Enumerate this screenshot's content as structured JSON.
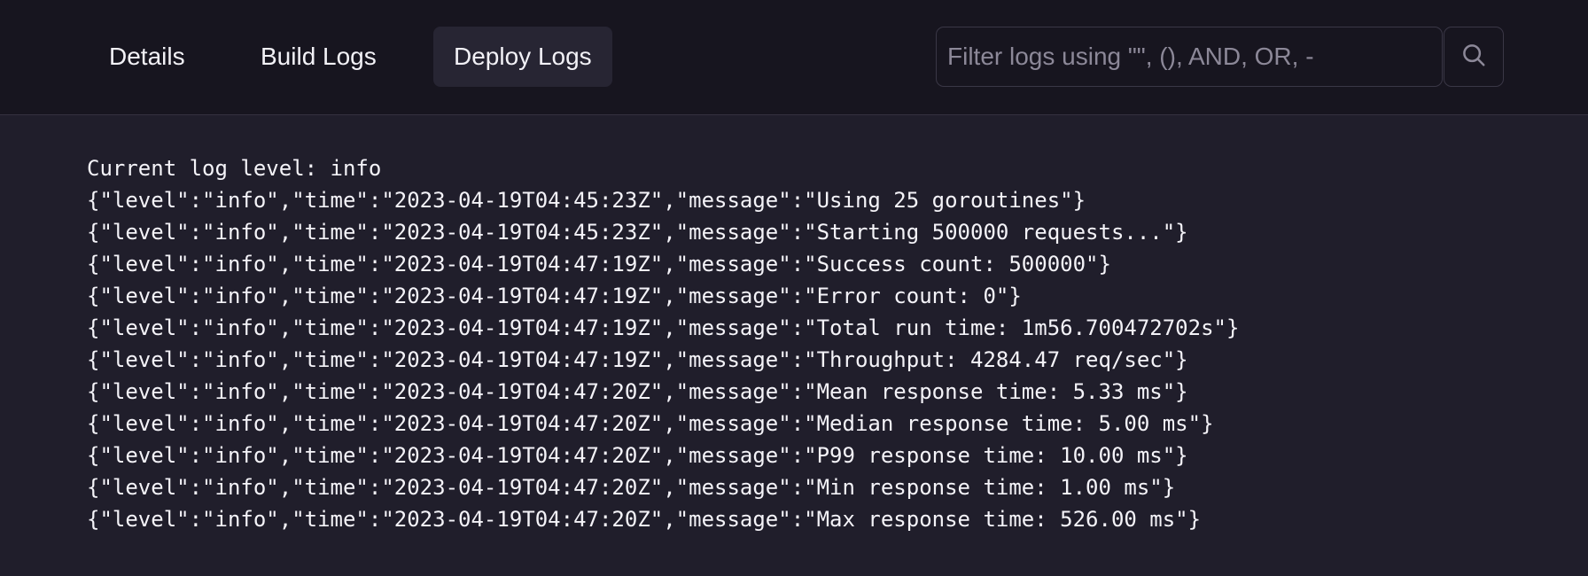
{
  "tabs": {
    "details": "Details",
    "build_logs": "Build Logs",
    "deploy_logs": "Deploy Logs"
  },
  "active_tab": "deploy_logs",
  "search": {
    "placeholder": "Filter logs using \"\", (), AND, OR, -",
    "value": "",
    "button_icon": "search-icon"
  },
  "logs": [
    "Current log level: info",
    "{\"level\":\"info\",\"time\":\"2023-04-19T04:45:23Z\",\"message\":\"Using 25 goroutines\"}",
    "{\"level\":\"info\",\"time\":\"2023-04-19T04:45:23Z\",\"message\":\"Starting 500000 requests...\"}",
    "{\"level\":\"info\",\"time\":\"2023-04-19T04:47:19Z\",\"message\":\"Success count: 500000\"}",
    "{\"level\":\"info\",\"time\":\"2023-04-19T04:47:19Z\",\"message\":\"Error count: 0\"}",
    "{\"level\":\"info\",\"time\":\"2023-04-19T04:47:19Z\",\"message\":\"Total run time: 1m56.700472702s\"}",
    "{\"level\":\"info\",\"time\":\"2023-04-19T04:47:19Z\",\"message\":\"Throughput: 4284.47 req/sec\"}",
    "{\"level\":\"info\",\"time\":\"2023-04-19T04:47:20Z\",\"message\":\"Mean response time: 5.33 ms\"}",
    "{\"level\":\"info\",\"time\":\"2023-04-19T04:47:20Z\",\"message\":\"Median response time: 5.00 ms\"}",
    "{\"level\":\"info\",\"time\":\"2023-04-19T04:47:20Z\",\"message\":\"P99 response time: 10.00 ms\"}",
    "{\"level\":\"info\",\"time\":\"2023-04-19T04:47:20Z\",\"message\":\"Min response time: 1.00 ms\"}",
    "{\"level\":\"info\",\"time\":\"2023-04-19T04:47:20Z\",\"message\":\"Max response time: 526.00 ms\"}"
  ],
  "colors": {
    "header_bg": "#17151f",
    "body_bg": "#201e2b",
    "active_tab_bg": "#272533",
    "border": "#3a3746",
    "text": "#ffffff",
    "placeholder": "#8c8898"
  }
}
